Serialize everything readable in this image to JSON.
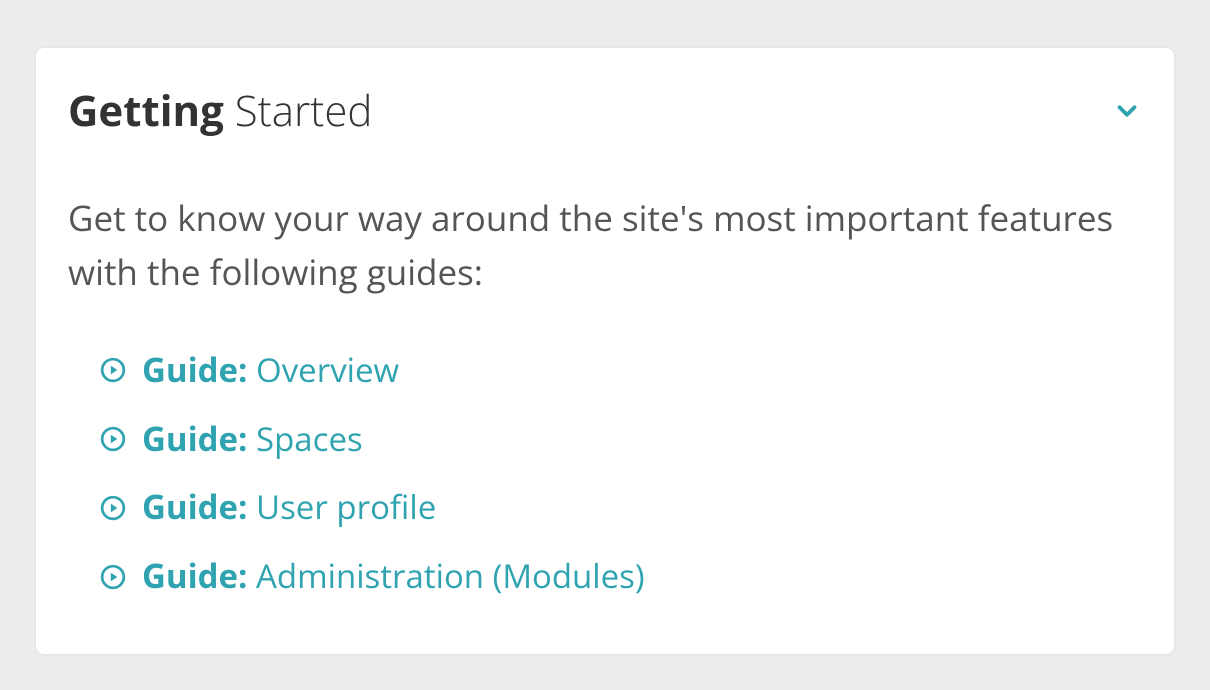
{
  "colors": {
    "accent": "#2fa3b0",
    "textPrimary": "#333333",
    "textSecondary": "#555555",
    "bg": "#ededed",
    "panel": "#ffffff"
  },
  "panel": {
    "title_bold": "Getting",
    "title_light": " Started",
    "description": "Get to know your way around the site's most important features with the following guides:"
  },
  "guides": [
    {
      "prefix": "Guide:",
      "title": " Overview"
    },
    {
      "prefix": "Guide:",
      "title": " Spaces"
    },
    {
      "prefix": "Guide:",
      "title": " User profile"
    },
    {
      "prefix": "Guide:",
      "title": " Administration (Modules)"
    }
  ]
}
